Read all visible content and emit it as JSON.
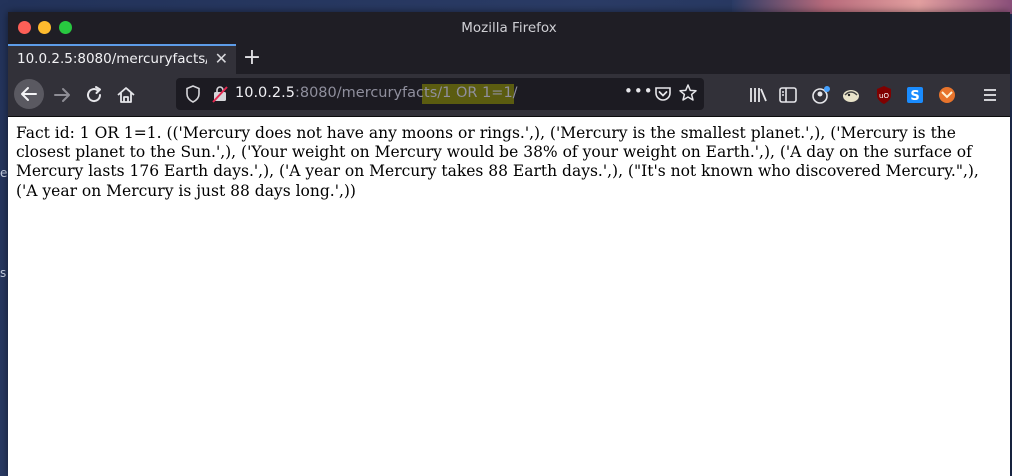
{
  "window": {
    "title": "Mozilla Firefox"
  },
  "tab": {
    "title": "10.0.2.5:8080/mercuryfacts/"
  },
  "urlbar": {
    "host": "10.0.2.5",
    "port": ":8080",
    "path": "/mercuryfacts",
    "query_path": "/1 OR 1=1/"
  },
  "page": {
    "text": "Fact id: 1 OR 1=1. (('Mercury does not have any moons or rings.',), ('Mercury is the smallest planet.',), ('Mercury is the closest planet to the Sun.',), ('Your weight on Mercury would be 38% of your weight on Earth.',), ('A day on the surface of Mercury lasts 176 Earth days.',), ('A year on Mercury takes 88 Earth days.',), (\"It's not known who discovered Mercury.\",), ('A year on Mercury is just 88 days long.',))"
  },
  "colors": {
    "titlebar": "#1f1e25",
    "toolbar": "#323139",
    "urlbar": "#1c1b22",
    "tab_accent": "#5d9ce8",
    "highlight": "#5b5c10"
  }
}
